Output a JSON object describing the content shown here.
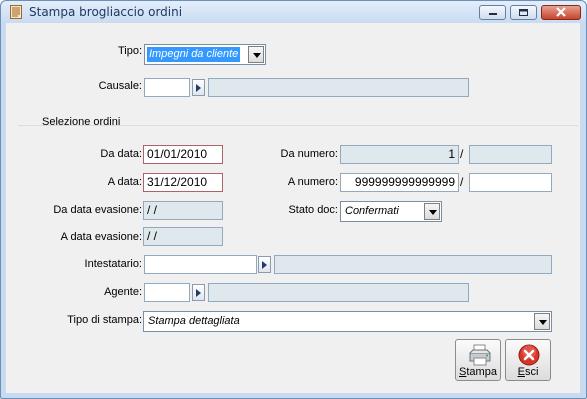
{
  "window": {
    "title": "Stampa brogliaccio ordini"
  },
  "tipo": {
    "label": "Tipo:",
    "value": "Impegni da cliente"
  },
  "causale": {
    "label": "Causale:",
    "code": "",
    "description": ""
  },
  "section": {
    "title": "Selezione ordini"
  },
  "da_data": {
    "label": "Da data:",
    "value": "01/01/2010"
  },
  "a_data": {
    "label": "A data:",
    "value": "31/12/2010"
  },
  "da_data_evasione": {
    "label": "Da data evasione:",
    "value": " /  /"
  },
  "a_data_evasione": {
    "label": "A data evasione:",
    "value": " /  /"
  },
  "da_numero": {
    "label": "Da numero:",
    "value": "1",
    "separator": "/",
    "serie": ""
  },
  "a_numero": {
    "label": "A numero:",
    "value": "999999999999999",
    "separator": "/",
    "serie": ""
  },
  "stato_doc": {
    "label": "Stato doc:",
    "value": "Confermati"
  },
  "intestatario": {
    "label": "Intestatario:",
    "code": "",
    "description": ""
  },
  "agente": {
    "label": "Agente:",
    "code": "",
    "description": ""
  },
  "tipo_stampa": {
    "label": "Tipo di stampa:",
    "value": "Stampa dettagliata"
  },
  "buttons": {
    "stampa": {
      "label_first": "S",
      "label_rest": "tampa"
    },
    "esci": {
      "label_first": "E",
      "label_rest": "sci"
    }
  },
  "colors": {
    "selection": "#3399ff",
    "readonly_field": "#dfe8ec",
    "window_frame": "#c8daf0"
  }
}
